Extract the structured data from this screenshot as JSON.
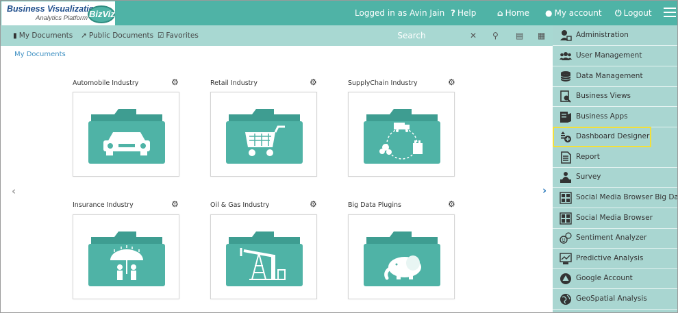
{
  "brand": {
    "title": "Business Visualization",
    "subtitle": "Analytics Platform",
    "badge": "BizViz"
  },
  "header": {
    "logged_in": "Logged in as Avin Jain",
    "help": "Help",
    "home": "Home",
    "account": "My account",
    "logout": "Logout"
  },
  "toolbar": {
    "my_documents": "My Documents",
    "public_documents": "Public Documents",
    "favorites": "Favorites",
    "search_placeholder": "Search"
  },
  "breadcrumb": "My Documents",
  "cards": [
    {
      "label": "Automobile Industry",
      "icon": "car-icon"
    },
    {
      "label": "Retail Industry",
      "icon": "shopping-cart-icon"
    },
    {
      "label": "SupplyChain Industry",
      "icon": "supply-chain-icon"
    },
    {
      "label": "Insurance Industry",
      "icon": "umbrella-family-icon"
    },
    {
      "label": "Oil & Gas Industry",
      "icon": "oil-pump-icon"
    },
    {
      "label": "Big Data Plugins",
      "icon": "elephant-icon"
    }
  ],
  "menu": [
    {
      "label": "Administration",
      "icon": "admin-user-icon"
    },
    {
      "label": "User Management",
      "icon": "users-icon"
    },
    {
      "label": "Data Management",
      "icon": "database-icon"
    },
    {
      "label": "Business Views",
      "icon": "business-views-icon"
    },
    {
      "label": "Business Apps",
      "icon": "business-apps-icon"
    },
    {
      "label": "Dashboard Designer",
      "icon": "dashboard-designer-icon"
    },
    {
      "label": "Report",
      "icon": "report-icon"
    },
    {
      "label": "Survey",
      "icon": "survey-icon"
    },
    {
      "label": "Social Media Browser Big Data",
      "icon": "social-media-bigdata-icon"
    },
    {
      "label": "Social Media Browser",
      "icon": "social-media-icon"
    },
    {
      "label": "Sentiment Analyzer",
      "icon": "sentiment-icon"
    },
    {
      "label": "Predictive Analysis",
      "icon": "predictive-icon"
    },
    {
      "label": "Google Account",
      "icon": "google-drive-icon"
    },
    {
      "label": "GeoSpatial Analysis",
      "icon": "geospatial-icon"
    }
  ],
  "colors": {
    "teal": "#4fb3a6",
    "toolbar": "#a8d8d2",
    "menu": "#a9d6d1",
    "folder": "#4fb3a6",
    "folder_dark": "#3e9d91",
    "highlight": "#f2e03b"
  }
}
